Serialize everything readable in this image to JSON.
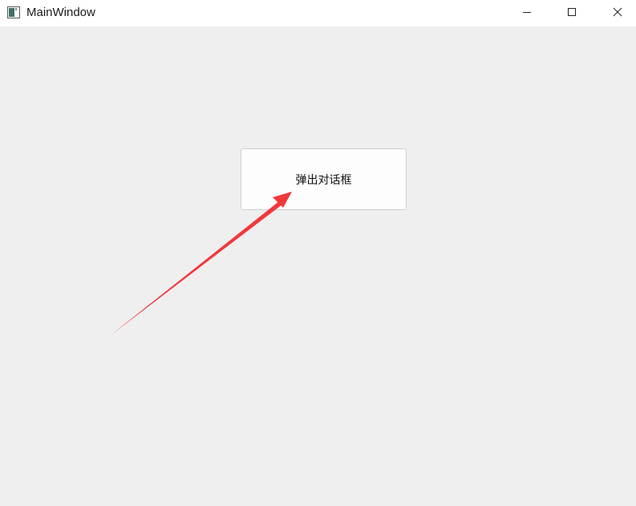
{
  "window": {
    "title": "MainWindow",
    "icon": "app-window-icon",
    "controls": {
      "minimize": "minimize-icon",
      "maximize": "maximize-icon",
      "close": "close-icon"
    }
  },
  "main": {
    "popup_button_label": "弹出对话框"
  },
  "annotation": {
    "arrow_color": "#f0393b"
  }
}
